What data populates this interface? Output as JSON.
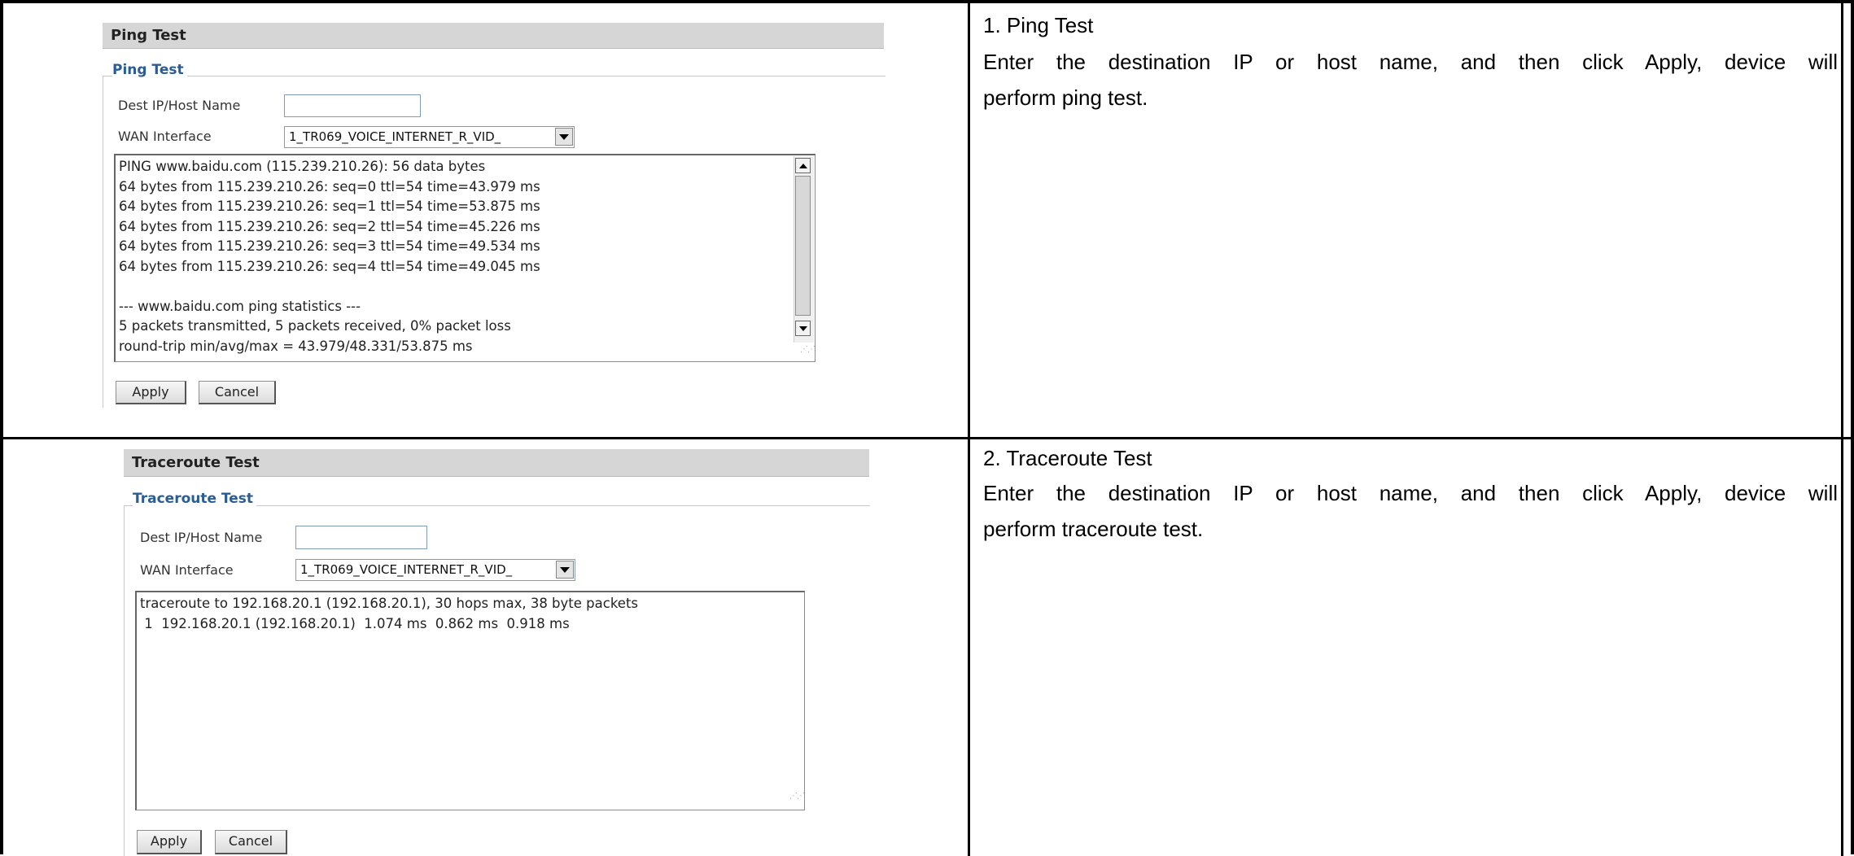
{
  "sections": [
    {
      "title": "Ping Test",
      "legend": "Ping Test",
      "dest_label": "Dest IP/Host Name",
      "dest_value": "",
      "wan_label": "WAN Interface",
      "wan_selected": "1_TR069_VOICE_INTERNET_R_VID_",
      "output_lines": "PING www.baidu.com (115.239.210.26): 56 data bytes\n64 bytes from 115.239.210.26: seq=0 ttl=54 time=43.979 ms\n64 bytes from 115.239.210.26: seq=1 ttl=54 time=53.875 ms\n64 bytes from 115.239.210.26: seq=2 ttl=54 time=45.226 ms\n64 bytes from 115.239.210.26: seq=3 ttl=54 time=49.534 ms\n64 bytes from 115.239.210.26: seq=4 ttl=54 time=49.045 ms\n\n--- www.baidu.com ping statistics ---\n5 packets transmitted, 5 packets received, 0% packet loss\nround-trip min/avg/max = 43.979/48.331/53.875 ms",
      "apply_label": "Apply",
      "cancel_label": "Cancel",
      "desc_heading": "1.  Ping Test",
      "desc_line1": "Enter the destination IP or host name, and then click Apply, device will",
      "desc_line2": "perform ping test."
    },
    {
      "title": "Traceroute Test",
      "legend": "Traceroute Test",
      "dest_label": "Dest IP/Host Name",
      "dest_value": "",
      "wan_label": "WAN Interface",
      "wan_selected": "1_TR069_VOICE_INTERNET_R_VID_",
      "output_lines": "traceroute to 192.168.20.1 (192.168.20.1), 30 hops max, 38 byte packets\n 1  192.168.20.1 (192.168.20.1)  1.074 ms  0.862 ms  0.918 ms",
      "apply_label": "Apply",
      "cancel_label": "Cancel",
      "desc_heading": "2.  Traceroute Test",
      "desc_line1": "Enter the destination IP or host name, and then click Apply, device will",
      "desc_line2": "perform traceroute test."
    }
  ]
}
